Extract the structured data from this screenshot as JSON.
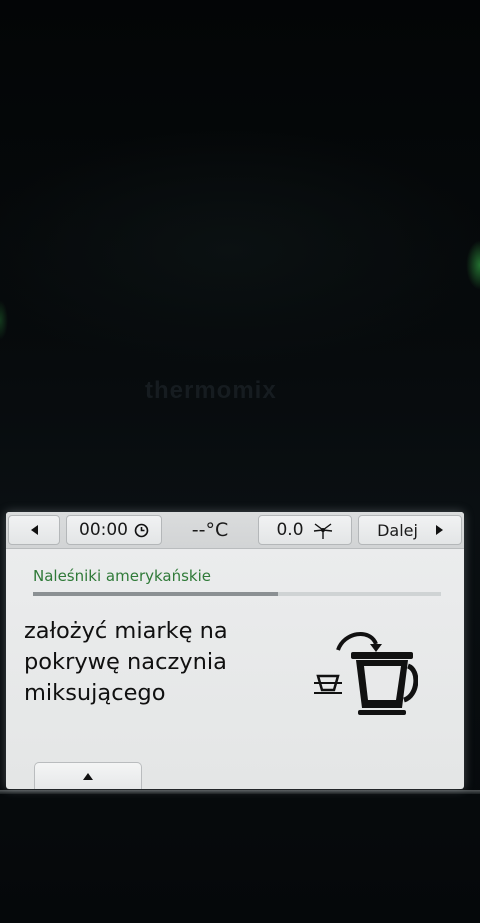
{
  "device": {
    "brand": "thermomix"
  },
  "topbar": {
    "time": "00:00",
    "temperature": "--°C",
    "speed": "0.0",
    "next_label": "Dalej"
  },
  "recipe": {
    "title": "Naleśniki amerykańskie",
    "progress_fraction": 0.6
  },
  "instruction": {
    "line1": "założyć miarkę na",
    "line2": "pokrywę naczynia",
    "line3": "miksującego"
  },
  "icons": {
    "back": "back-arrow-icon",
    "clock": "clock-icon",
    "speed": "blade-icon",
    "next": "next-arrow-icon",
    "illustration": "measuring-cup-on-lid-icon",
    "expand": "expand-up-icon"
  }
}
